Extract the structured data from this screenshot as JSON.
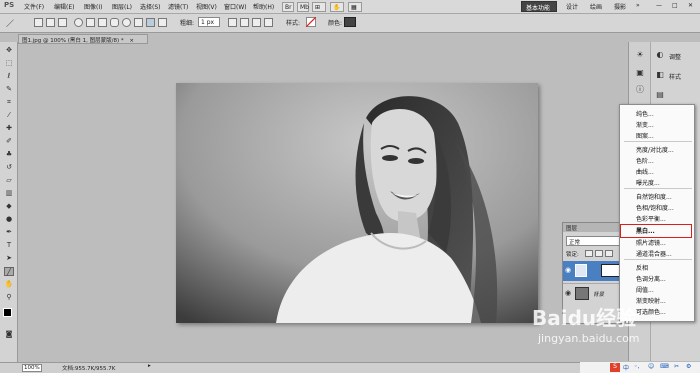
{
  "app": {
    "logo": "PS",
    "menus": [
      "文件(F)",
      "编辑(E)",
      "图像(I)",
      "图层(L)",
      "选择(S)",
      "滤镜(T)",
      "视图(V)",
      "窗口(W)",
      "帮助(H)"
    ],
    "workspace": {
      "active": "基本功能",
      "others": [
        "设计",
        "绘画",
        "摄影"
      ]
    }
  },
  "options": {
    "weight_label": "粗细:",
    "weight_value": "1 px",
    "style_label": "样式:",
    "color_label": "颜色:"
  },
  "document": {
    "tab_title": "图1.jpg @ 100% (黑白 1, 图层蒙版/8) *",
    "close": "×"
  },
  "status": {
    "zoom": "100%",
    "doc": "文档:955.7K/955.7K"
  },
  "dock": {
    "adjust_label": "调整",
    "styles_label": "样式"
  },
  "layers": {
    "title": "图层",
    "blend_mode": "正常",
    "lock_label": "锁定:",
    "background_label": "背景"
  },
  "adjust_menu": {
    "items": [
      "纯色...",
      "渐变...",
      "图案...",
      "亮度/对比度...",
      "色阶...",
      "曲线...",
      "曝光度...",
      "自然饱和度...",
      "色相/饱和度...",
      "色彩平衡...",
      "黑白...",
      "照片滤镜...",
      "通道混合器...",
      "反相",
      "色调分离...",
      "阈值...",
      "渐变映射...",
      "可选颜色..."
    ],
    "highlighted": "黑白..."
  },
  "watermark": {
    "brand": "Baidu经验",
    "url": "jingyan.baidu.com"
  },
  "taskbar": {
    "ime": "中"
  }
}
